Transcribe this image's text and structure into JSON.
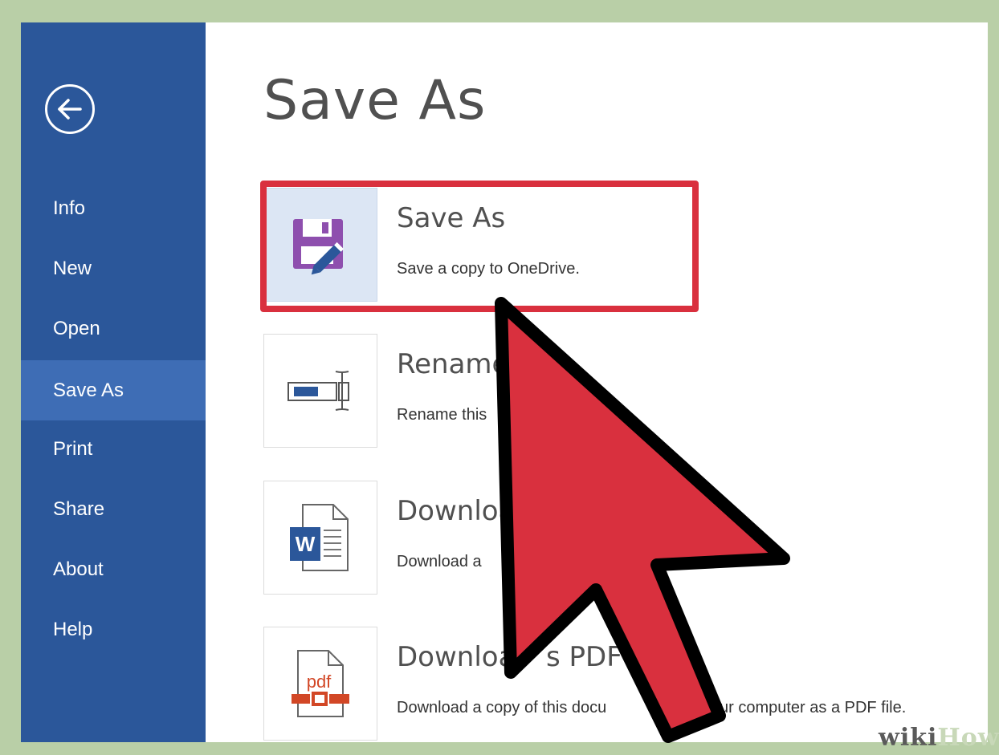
{
  "sidebar": {
    "items": [
      {
        "label": "Info",
        "active": false
      },
      {
        "label": "New",
        "active": false
      },
      {
        "label": "Open",
        "active": false
      },
      {
        "label": "Save As",
        "active": true
      },
      {
        "label": "Print",
        "active": false
      },
      {
        "label": "Share",
        "active": false
      },
      {
        "label": "About",
        "active": false
      },
      {
        "label": "Help",
        "active": false
      }
    ]
  },
  "main": {
    "title": "Save As",
    "options": [
      {
        "title": "Save As",
        "description": "Save a copy to OneDrive.",
        "icon": "floppy-disk-pencil-icon"
      },
      {
        "title": "Rename",
        "description": "Rename this",
        "icon": "rename-icon"
      },
      {
        "title": "Downloa",
        "description": "Download a",
        "icon": "word-document-icon"
      },
      {
        "title": "Downloa",
        "title_tail": "s PDF",
        "description": "Download a copy of this docu",
        "description_tail": "ur computer as a PDF file.",
        "icon": "pdf-icon"
      }
    ]
  },
  "watermark": {
    "wiki": "wiki",
    "how": "How"
  },
  "colors": {
    "sidebar": "#2b579a",
    "sidebar_active": "#3e6db5",
    "highlight_border": "#d9303e",
    "arrow_fill": "#d9303e",
    "frame_background": "#b9cfa7",
    "disk_purple": "#8e4fae",
    "pencil_blue": "#2b579a"
  }
}
